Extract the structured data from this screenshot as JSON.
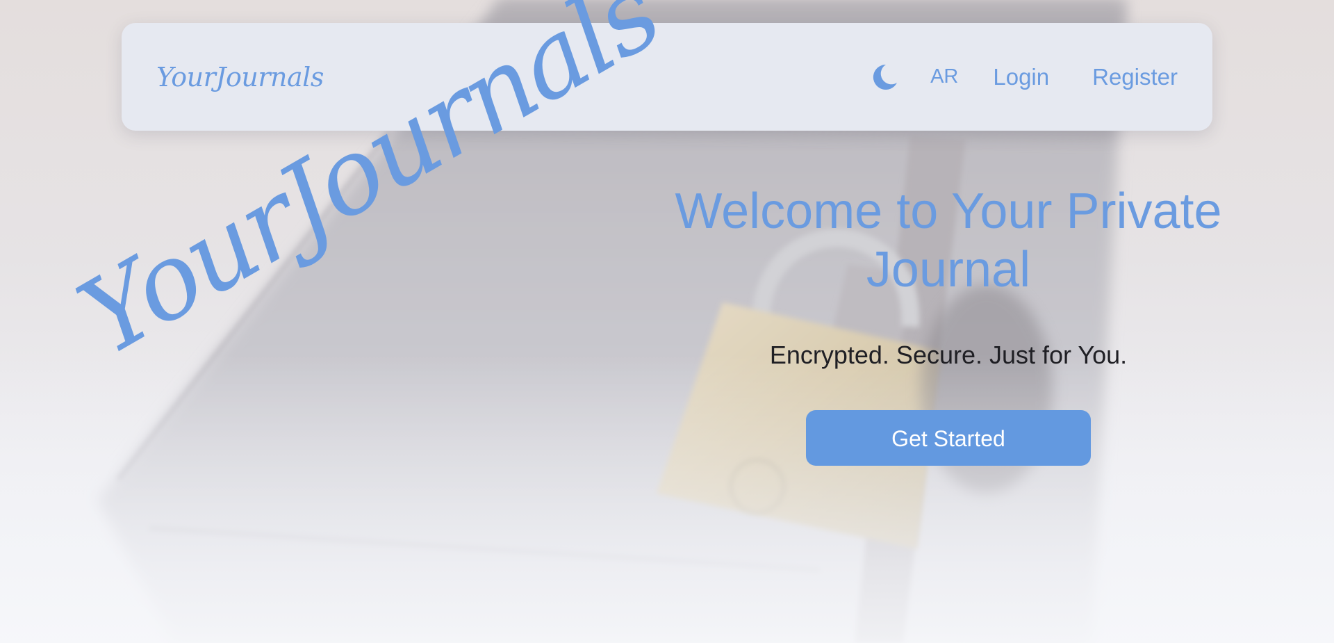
{
  "navbar": {
    "brand": "YourJournals",
    "theme_toggle_icon": "moon-icon",
    "lang_label": "AR",
    "login_label": "Login",
    "register_label": "Register"
  },
  "hero": {
    "watermark": "YourJournals",
    "title": "Welcome to Your Private Journal",
    "subtitle": "Encrypted. Secure. Just for You.",
    "cta_label": "Get Started"
  },
  "background": {
    "image": "locked-journal-photo"
  },
  "colors": {
    "accent": "#6a9be0",
    "button": "#6399e0",
    "navbar_bg": "#e6e9f1",
    "text_dark": "#1f1f24"
  }
}
